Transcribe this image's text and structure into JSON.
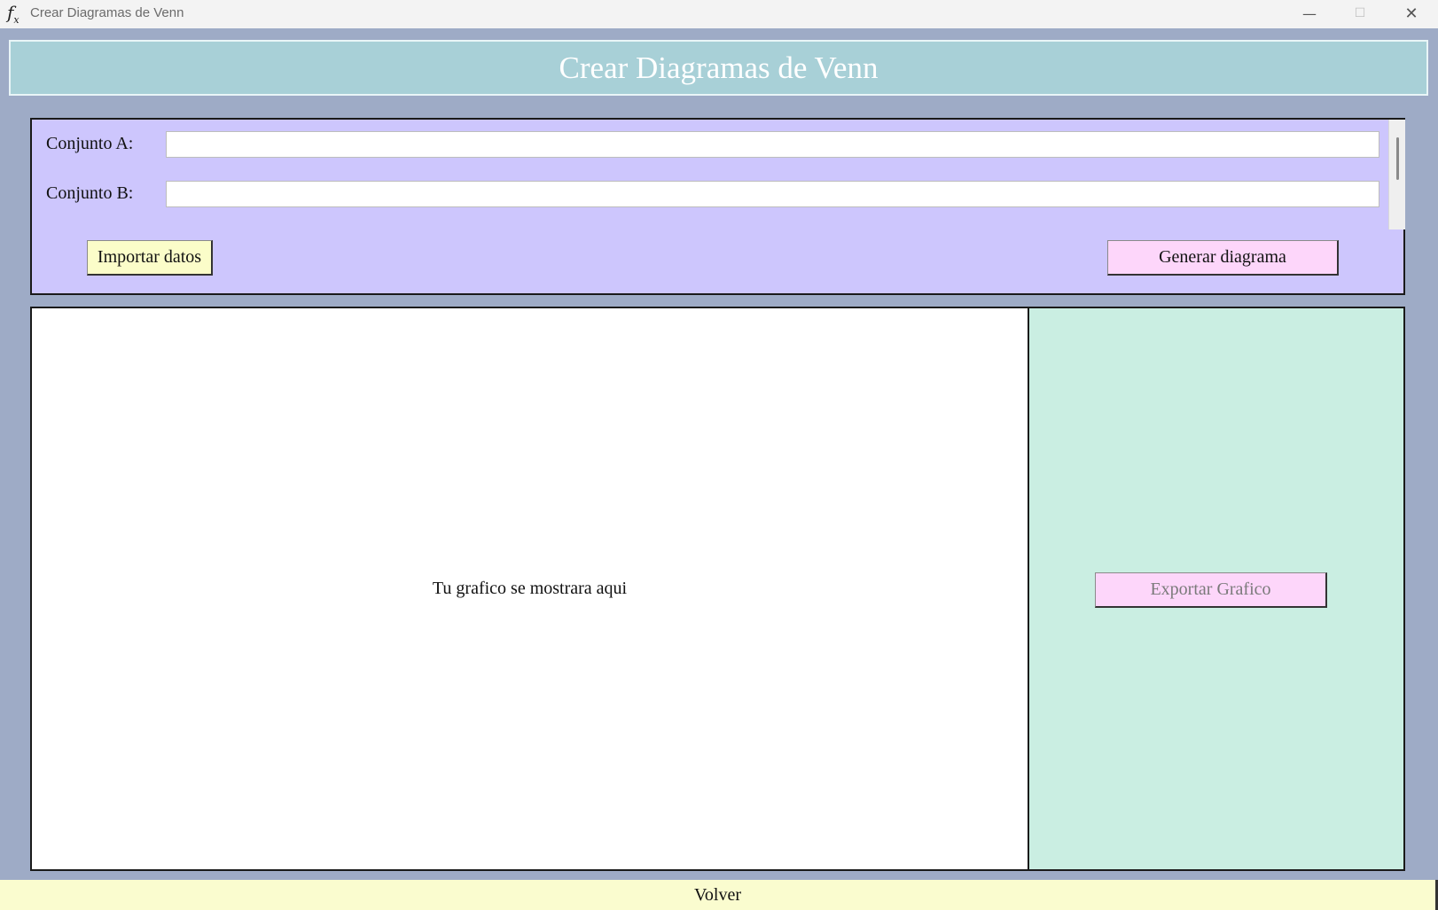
{
  "window": {
    "title": "Crear Diagramas de Venn",
    "icon": "fx-function-icon"
  },
  "header": {
    "title": "Crear Diagramas de Venn"
  },
  "inputs": {
    "set_a_label": "Conjunto A:",
    "set_a_value": "",
    "set_b_label": "Conjunto B:",
    "set_b_value": ""
  },
  "actions": {
    "import_label": "Importar datos",
    "generate_label": "Generar diagrama"
  },
  "graph": {
    "placeholder": "Tu grafico se mostrara aqui"
  },
  "export": {
    "label": "Exportar Grafico",
    "enabled": false
  },
  "footer": {
    "back_label": "Volver"
  },
  "colors": {
    "background": "#9eabc6",
    "header": "#a8d0d7",
    "input_panel": "#cdc6fd",
    "export_panel": "#caeee2",
    "button_yellow": "#fbfdc9",
    "button_pink": "#fdd6fa"
  }
}
